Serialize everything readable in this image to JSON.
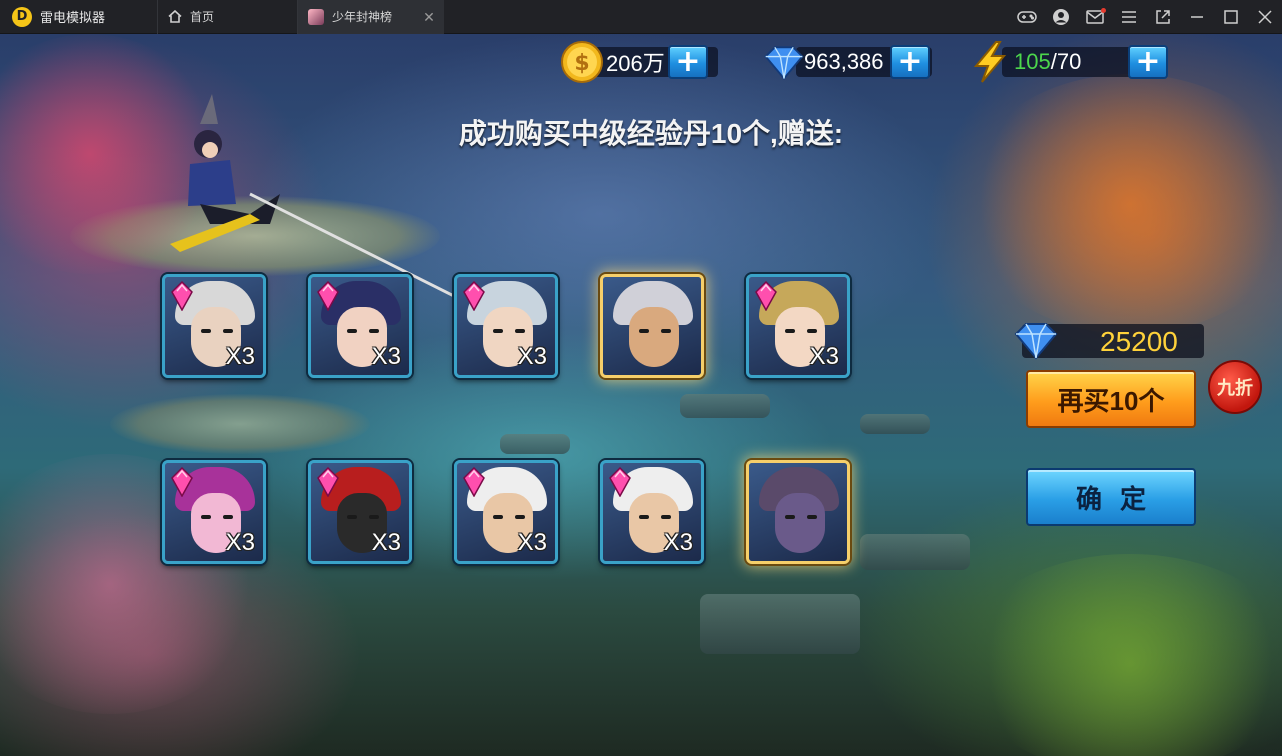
{
  "emulator": {
    "brand": "雷电模拟器",
    "brand_logo_letter": "D",
    "tabs": [
      {
        "label": "首页",
        "icon": "home-icon"
      },
      {
        "label": "少年封神榜",
        "icon": "game-thumbnail"
      }
    ],
    "close_glyph": "✕",
    "window_icons": [
      "gamepad-icon",
      "account-icon",
      "mail-icon",
      "menu-icon",
      "popout-icon",
      "minimize-icon",
      "maximize-icon",
      "close-icon"
    ]
  },
  "currency": {
    "gold": {
      "icon": "gold-coin-icon",
      "value": "206万",
      "plus": "+"
    },
    "diamond": {
      "icon": "diamond-icon",
      "value": "963,386",
      "plus": "+"
    },
    "stamina": {
      "icon": "lightning-icon",
      "current": "105",
      "max": "/70",
      "plus": "+"
    }
  },
  "headline": "成功购买中级经验丹10个,赠送:",
  "rewards": [
    {
      "qty": "X3",
      "rarity": "normal",
      "hair": "#d8d8d8",
      "skin": "#e9d2c0"
    },
    {
      "qty": "X3",
      "rarity": "normal",
      "hair": "#2a2f66",
      "skin": "#f1d2c2"
    },
    {
      "qty": "X3",
      "rarity": "normal",
      "hair": "#c8d4de",
      "skin": "#f0d6c2"
    },
    {
      "qty": "",
      "rarity": "gold",
      "hair": "#d0d0d8",
      "skin": "#d9a97e"
    },
    {
      "qty": "X3",
      "rarity": "normal",
      "hair": "#c6a85a",
      "skin": "#f3d8c4"
    },
    {
      "qty": "X3",
      "rarity": "normal",
      "hair": "#a8329a",
      "skin": "#f2b8d4"
    },
    {
      "qty": "X3",
      "rarity": "normal",
      "hair": "#b81e1e",
      "skin": "#2a2a2a"
    },
    {
      "qty": "X3",
      "rarity": "normal",
      "hair": "#eeeeee",
      "skin": "#e9c7a6"
    },
    {
      "qty": "X3",
      "rarity": "normal",
      "hair": "#eeeeee",
      "skin": "#e9c7a6"
    },
    {
      "qty": "",
      "rarity": "gold",
      "hair": "#5a4a6a",
      "skin": "#6a5a8a"
    }
  ],
  "purchase": {
    "price_icon": "diamond-icon",
    "price": "25200",
    "buy_again_label": "再买10个",
    "discount_badge": "九折",
    "confirm_label": "确定"
  }
}
